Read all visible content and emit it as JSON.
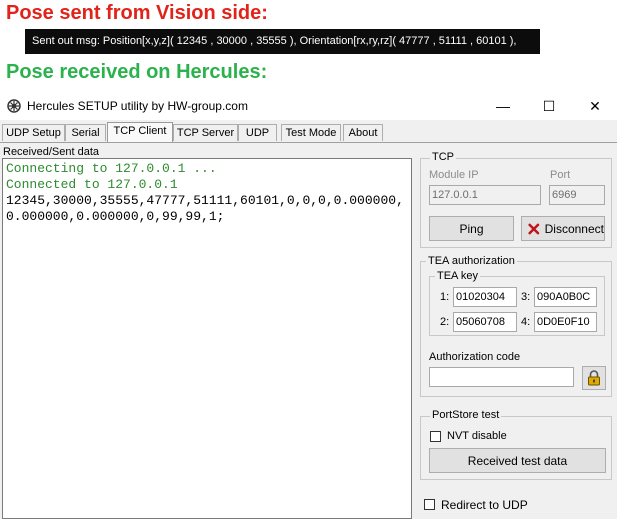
{
  "annotations": {
    "vision_heading": "Pose sent from Vision side:",
    "vision_message": "Sent out msg: Position[x,y,z]( 12345 , 30000 , 35555 ), Orientation[rx,ry,rz]( 47777 , 51111 , 60101 ),",
    "hercules_heading": "Pose received on Hercules:"
  },
  "window": {
    "title": "Hercules SETUP utility by HW-group.com",
    "minimize": "—",
    "maximize": "☐",
    "close": "✕"
  },
  "tabs": [
    {
      "label": "UDP Setup"
    },
    {
      "label": "Serial"
    },
    {
      "label": "TCP Client",
      "active": true
    },
    {
      "label": "TCP Server"
    },
    {
      "label": "UDP"
    },
    {
      "label": "Test Mode"
    },
    {
      "label": "About"
    }
  ],
  "log": {
    "label": "Received/Sent data",
    "line1": "Connecting to 127.0.0.1 ...",
    "line2": "Connected to 127.0.0.1",
    "line3": "12345,30000,35555,47777,51111,60101,0,0,0,0.000000,0.000000,0.000000,0,99,99,1;"
  },
  "tcp": {
    "group_label": "TCP",
    "module_ip_label": "Module IP",
    "module_ip_value": "127.0.0.1",
    "port_label": "Port",
    "port_value": "6969",
    "ping_label": "Ping",
    "disconnect_label": "Disconnect"
  },
  "tea": {
    "group_label": "TEA authorization",
    "key_label": "TEA key",
    "keys": [
      {
        "n": "1:",
        "v": "01020304"
      },
      {
        "n": "3:",
        "v": "090A0B0C"
      },
      {
        "n": "2:",
        "v": "05060708"
      },
      {
        "n": "4:",
        "v": "0D0E0F10"
      }
    ],
    "auth_code_label": "Authorization code",
    "auth_code_value": ""
  },
  "portstore": {
    "group_label": "PortStore test",
    "nvt_disable_label": "NVT disable",
    "received_test_data_label": "Received test data"
  },
  "redirect_label": "Redirect to UDP",
  "colors": {
    "heading_red": "#e2231a",
    "heading_green": "#2bb24c",
    "log_green": "#2e8b2e"
  }
}
